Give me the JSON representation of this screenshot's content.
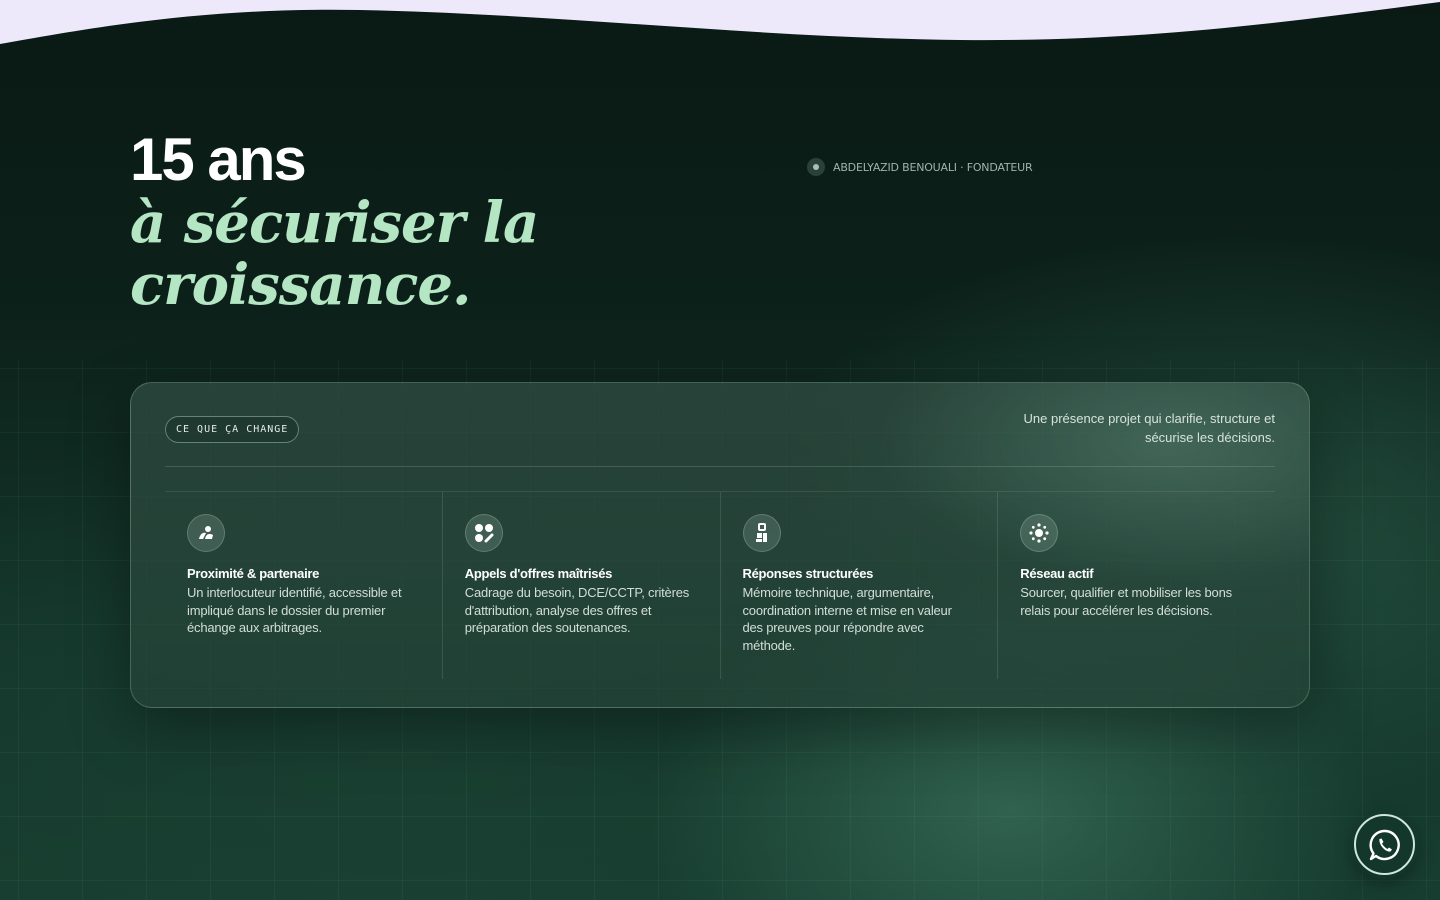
{
  "hero": {
    "line1": "15 ans",
    "line2": "à sécuriser la",
    "line3": "croissance."
  },
  "founder": {
    "label": "ABDELYAZID BENOUALI · FONDATEUR"
  },
  "card": {
    "pill_label": "CE QUE ÇA CHANGE",
    "tagline": "Une présence projet qui clarifie, structure et sécurise les décisions.",
    "features": [
      {
        "icon": "people-icon",
        "title": "Proximité & partenaire",
        "description": "Un interlocuteur identifié, accessible et impliqué dans le dossier du premier échange aux arbitrages."
      },
      {
        "icon": "dots-grid-icon",
        "title": "Appels d'offres maîtrisés",
        "description": "Cadrage du besoin, DCE/CCTP, critères d'attribution, analyse des offres et préparation des soutenances."
      },
      {
        "icon": "blocks-icon",
        "title": "Réponses structurées",
        "description": "Mémoire technique, argumentaire, coordination interne et mise en valeur des preuves pour répondre avec méthode."
      },
      {
        "icon": "network-icon",
        "title": "Réseau actif",
        "description": "Sourcer, qualifier et mobiliser les bons relais pour accélérer les décisions."
      }
    ]
  },
  "colors": {
    "background": "#0b1c16",
    "accent_green": "#b5e6c4",
    "wave": "#ede9fb"
  },
  "whatsapp": {
    "icon": "whatsapp-icon"
  }
}
